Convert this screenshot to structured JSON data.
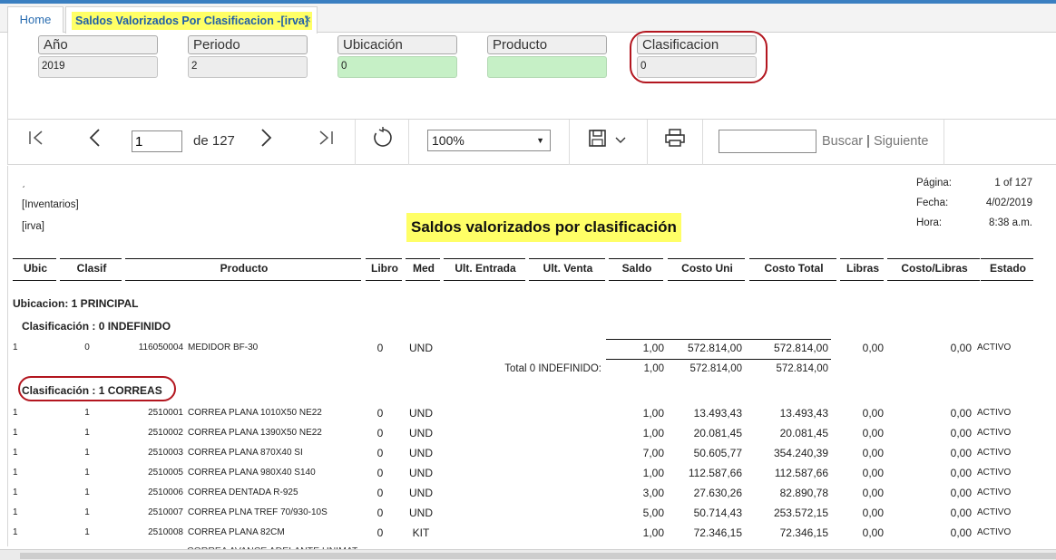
{
  "tabs": {
    "home": "Home",
    "active": "Saldos Valorizados Por Clasificacion -[irva]",
    "close_glyph": "×"
  },
  "params": [
    {
      "label": "Año",
      "value": "2019",
      "style": "gray"
    },
    {
      "label": "Periodo",
      "value": "2",
      "style": "gray"
    },
    {
      "label": "Ubicación",
      "value": "0",
      "style": "green"
    },
    {
      "label": "Producto",
      "value": "",
      "style": "green"
    },
    {
      "label": "Clasificacion",
      "value": "0",
      "style": "gray"
    }
  ],
  "toolbar": {
    "first_icon": "first-page-icon",
    "prev_icon": "previous-page-icon",
    "current_page": "1",
    "of_pages": "de 127",
    "next_icon": "next-page-icon",
    "last_icon": "last-page-icon",
    "refresh_icon": "refresh-icon",
    "zoom": "100%",
    "save_icon": "save-icon",
    "print_icon": "print-icon",
    "search_label": "Buscar",
    "search_sep": "|",
    "next_label": "Siguiente"
  },
  "report": {
    "corner_mark": "ˏ",
    "module": "[Inventarios]",
    "company": "[irva]",
    "title": "Saldos valorizados por clasificación",
    "meta": [
      {
        "label": "Página:",
        "value": "1 of 127"
      },
      {
        "label": "Fecha:",
        "value": "4/02/2019"
      },
      {
        "label": "Hora:",
        "value": "8:38 a.m."
      }
    ],
    "columns": [
      "Ubic",
      "Clasif",
      "Producto",
      "Libro",
      "Med",
      "Ult. Entrada",
      "Ult. Venta",
      "Saldo",
      "Costo Uni",
      "Costo Total",
      "Libras",
      "Costo/Libras",
      "Estado"
    ],
    "location_heading": "Ubicacion: 1  PRINCIPAL",
    "group0": {
      "heading": "Clasificación : 0  INDEFINIDO",
      "rows": [
        {
          "ubic": "1",
          "clasif": "0",
          "code": "116050004",
          "name": "MEDIDOR BF-30",
          "libro": "0",
          "med": "UND",
          "saldo": "1,00",
          "costo_uni": "572.814,00",
          "costo_total": "572.814,00",
          "libras": "0,00",
          "costo_libras": "0,00",
          "estado": "ACTIVO"
        }
      ],
      "total_label": "Total 0  INDEFINIDO:",
      "total_saldo": "1,00",
      "total_costo_uni": "572.814,00",
      "total_costo_total": "572.814,00"
    },
    "group1": {
      "heading": "Clasificación : 1  CORREAS",
      "rows": [
        {
          "ubic": "1",
          "clasif": "1",
          "code": "2510001",
          "name": "CORREA PLANA 1010X50 NE22",
          "libro": "0",
          "med": "UND",
          "saldo": "1,00",
          "costo_uni": "13.493,43",
          "costo_total": "13.493,43",
          "libras": "0,00",
          "costo_libras": "0,00",
          "estado": "ACTIVO"
        },
        {
          "ubic": "1",
          "clasif": "1",
          "code": "2510002",
          "name": "CORREA PLANA 1390X50 NE22",
          "libro": "0",
          "med": "UND",
          "saldo": "1,00",
          "costo_uni": "20.081,45",
          "costo_total": "20.081,45",
          "libras": "0,00",
          "costo_libras": "0,00",
          "estado": "ACTIVO"
        },
        {
          "ubic": "1",
          "clasif": "1",
          "code": "2510003",
          "name": "CORREA PLANA 870X40 SI",
          "libro": "0",
          "med": "UND",
          "saldo": "7,00",
          "costo_uni": "50.605,77",
          "costo_total": "354.240,39",
          "libras": "0,00",
          "costo_libras": "0,00",
          "estado": "ACTIVO"
        },
        {
          "ubic": "1",
          "clasif": "1",
          "code": "2510005",
          "name": "CORREA PLANA 980X40 S140",
          "libro": "0",
          "med": "UND",
          "saldo": "1,00",
          "costo_uni": "112.587,66",
          "costo_total": "112.587,66",
          "libras": "0,00",
          "costo_libras": "0,00",
          "estado": "ACTIVO"
        },
        {
          "ubic": "1",
          "clasif": "1",
          "code": "2510006",
          "name": "CORREA DENTADA R-925",
          "libro": "0",
          "med": "UND",
          "saldo": "3,00",
          "costo_uni": "27.630,26",
          "costo_total": "82.890,78",
          "libras": "0,00",
          "costo_libras": "0,00",
          "estado": "ACTIVO"
        },
        {
          "ubic": "1",
          "clasif": "1",
          "code": "2510007",
          "name": "CORREA PLNA TREF 70/930-10S",
          "libro": "0",
          "med": "UND",
          "saldo": "5,00",
          "costo_uni": "50.714,43",
          "costo_total": "253.572,15",
          "libras": "0,00",
          "costo_libras": "0,00",
          "estado": "ACTIVO"
        },
        {
          "ubic": "1",
          "clasif": "1",
          "code": "2510008",
          "name": "CORREA PLANA 82CM",
          "libro": "0",
          "med": "KIT",
          "saldo": "1,00",
          "costo_uni": "72.346,15",
          "costo_total": "72.346,15",
          "libras": "0,00",
          "costo_libras": "0,00",
          "estado": "ACTIVO"
        }
      ],
      "partial_row": "CORREA AVANCE ADELANTE UNIMAT"
    },
    "highlight_color": "#ffff66",
    "annotation_color": "#b3161f"
  }
}
